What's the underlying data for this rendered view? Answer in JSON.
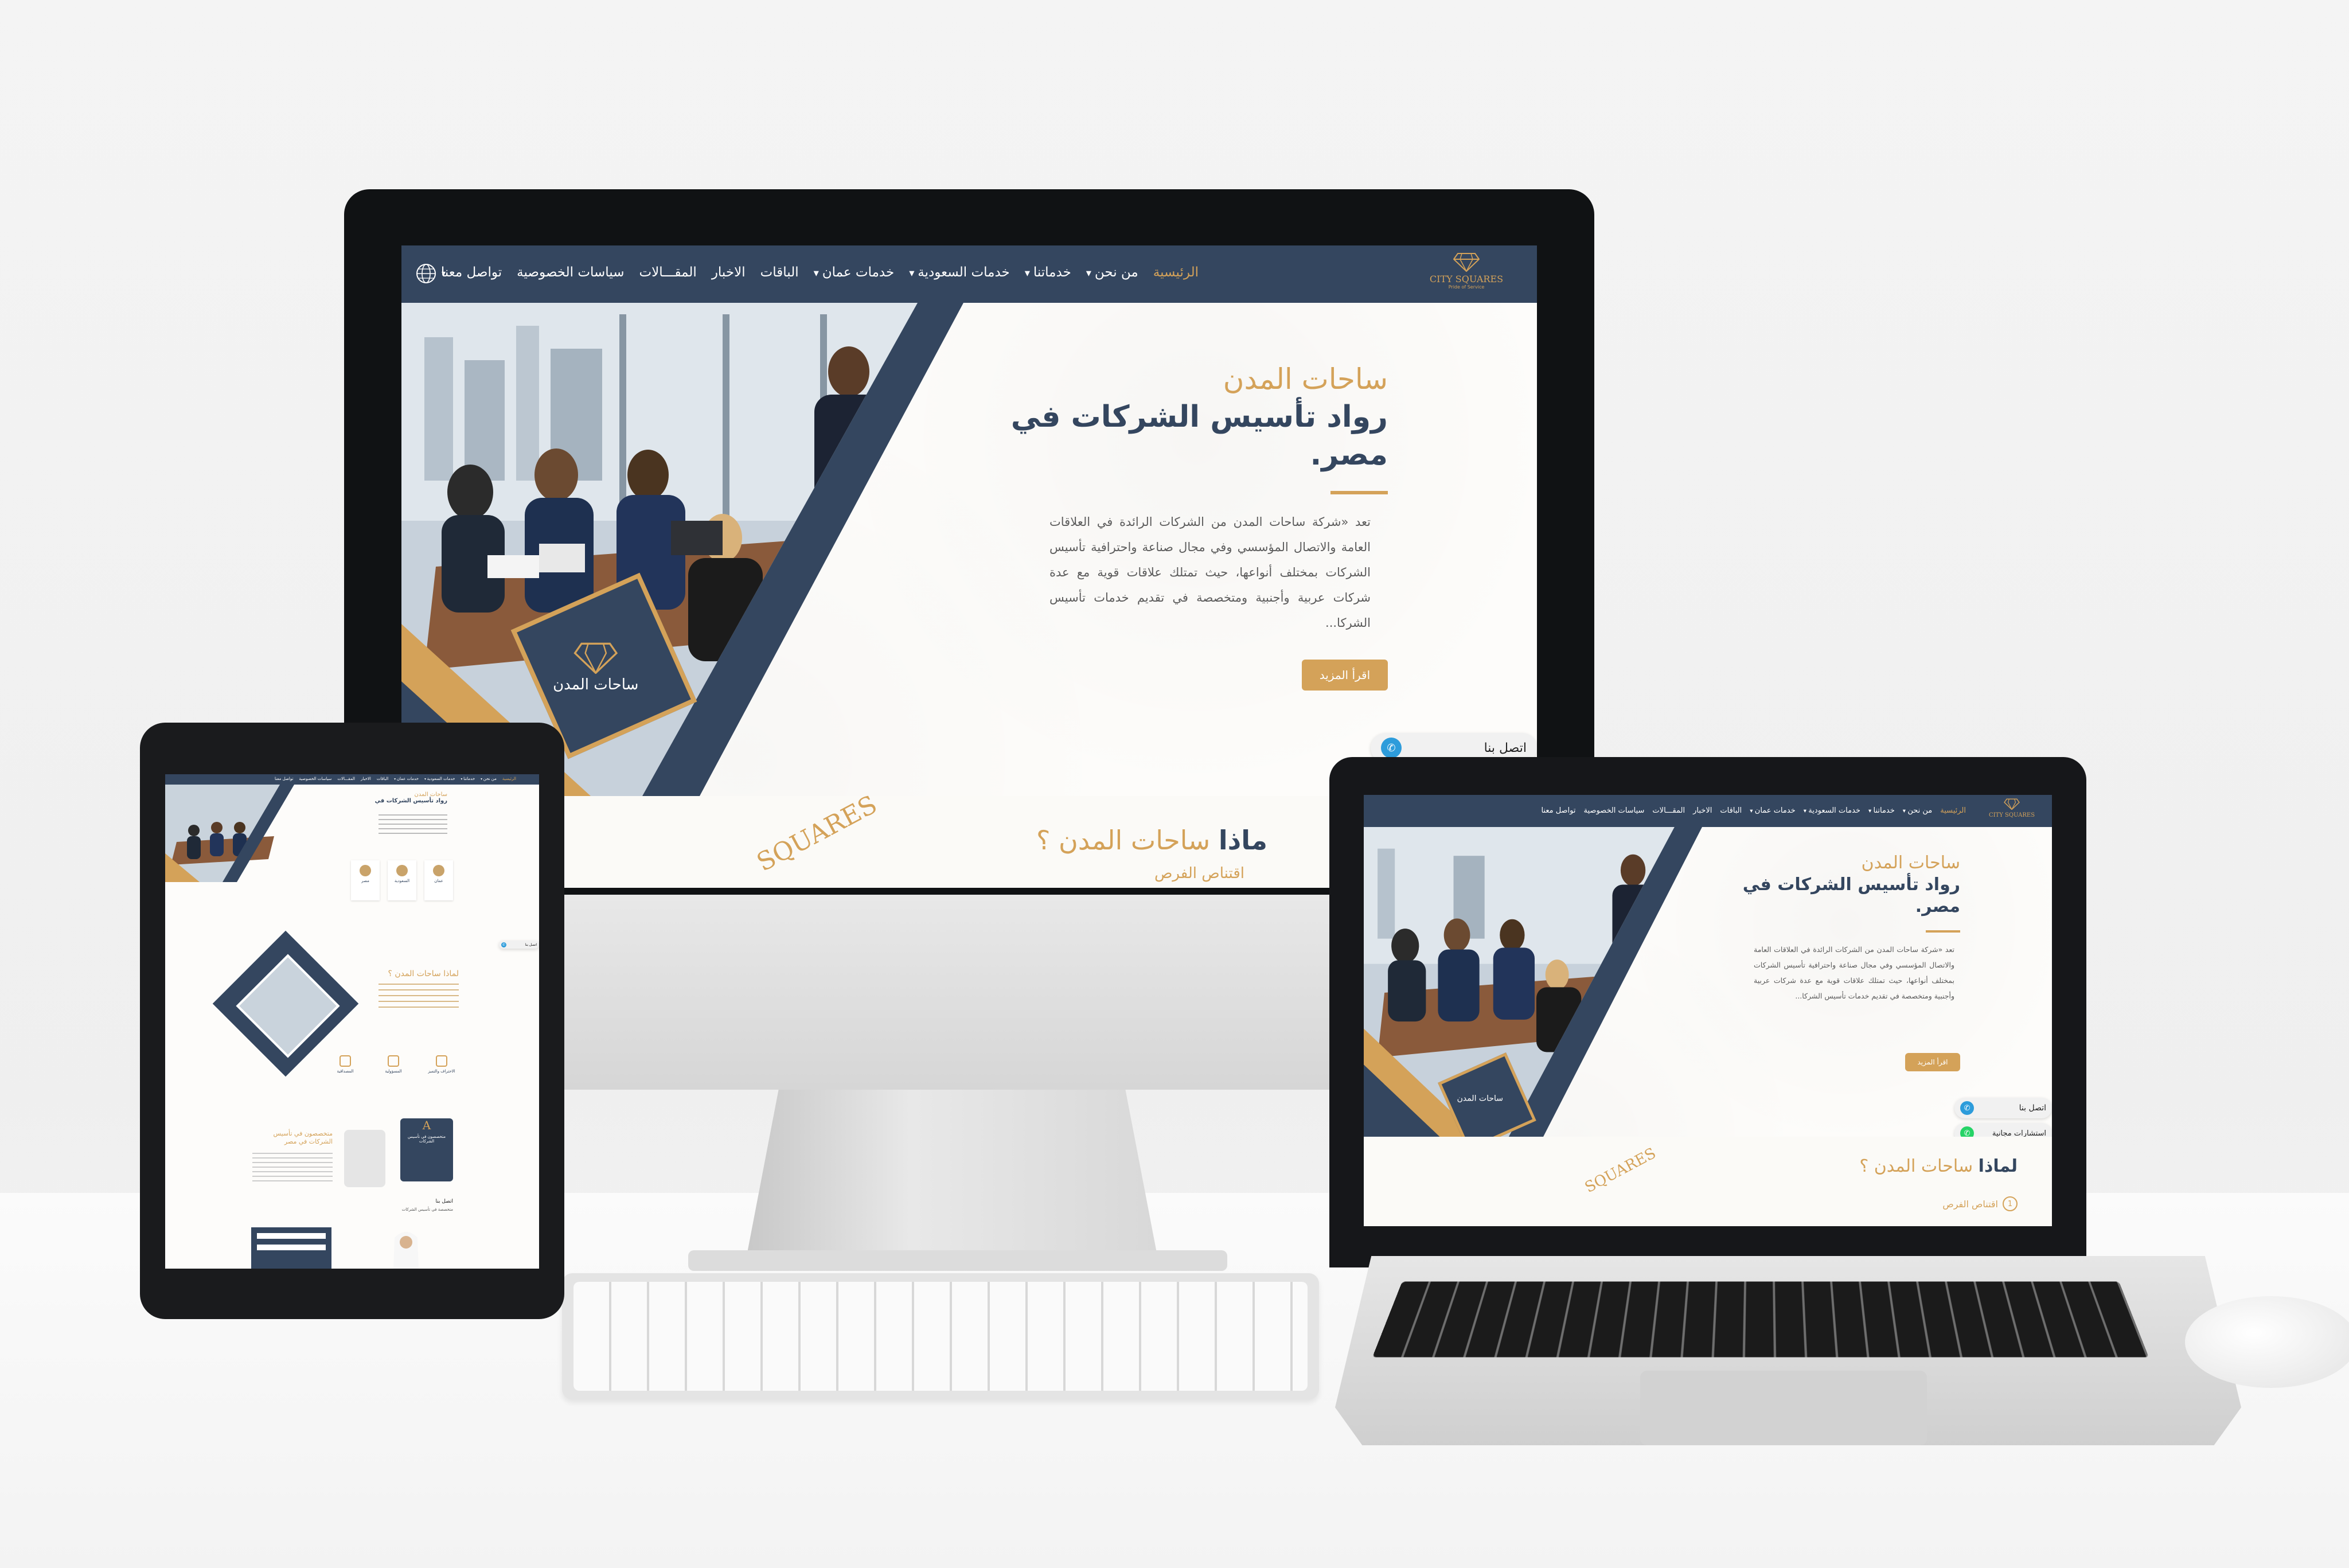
{
  "site": {
    "logo_text": "CITY SQUARES",
    "logo_subtext": "Pride of Service",
    "nav": [
      {
        "label": "الرئيسية",
        "active": true,
        "dropdown": false
      },
      {
        "label": "من نحن",
        "active": false,
        "dropdown": true
      },
      {
        "label": "خدماتنا",
        "active": false,
        "dropdown": true
      },
      {
        "label": "خدمات السعودية",
        "active": false,
        "dropdown": true
      },
      {
        "label": "خدمات عمان",
        "active": false,
        "dropdown": true
      },
      {
        "label": "الباقات",
        "active": false,
        "dropdown": false
      },
      {
        "label": "الاخبار",
        "active": false,
        "dropdown": false
      },
      {
        "label": "المقـــالات",
        "active": false,
        "dropdown": false
      },
      {
        "label": "سياسات الخصوصية",
        "active": false,
        "dropdown": false
      },
      {
        "label": "تواصل معنا",
        "active": false,
        "dropdown": false
      }
    ],
    "hero": {
      "title_gold": "ساحات المدن",
      "title_line2": "رواد تأسيس الشركات في",
      "title_line3": "مصر.",
      "paragraph": "تعد «شركة ساحات المدن من الشركات الرائدة في العلاقات العامة والاتصال المؤسسي وفي مجال صناعة واحترافية تأسيس الشركات بمختلف أنواعها، حيث تمتلك علاقات قوية مع عدة شركات عربية وأجنبية ومتخصصة في تقديم خدمات تأسيس الشركا...",
      "button": "اقرأ المزيد",
      "badge_text": "ساحات المدن"
    },
    "contact_label": "اتصل بنا",
    "consult_label": "استشارات مجانية",
    "why_title_gold": "ساحات المدن ؟",
    "why_title_prefix": "لماذا",
    "why_title_prefix_cut": "ماذا",
    "why_item1": "اقتناص الفرص",
    "why_item1_num": "1",
    "squares_wordmark": "SQUARES",
    "tablet": {
      "cards": [
        "عمان",
        "السعودية",
        "مصر"
      ],
      "why_title": "لماذا ساحات المدن ؟",
      "features": [
        "الاحتراف والتميز",
        "المسؤولية",
        "المصداقية"
      ],
      "promo_title": "متخصصون في تأسيس الشركات في مصر",
      "dark_card_letter": "A",
      "dark_card_text": "متخصصون في تأسيس الشركات",
      "call_label": "اتصل بنا",
      "call_text": "متخصصة في تأسيس الشركات"
    }
  },
  "colors": {
    "navy": "#34465f",
    "gold": "#d4a259"
  }
}
